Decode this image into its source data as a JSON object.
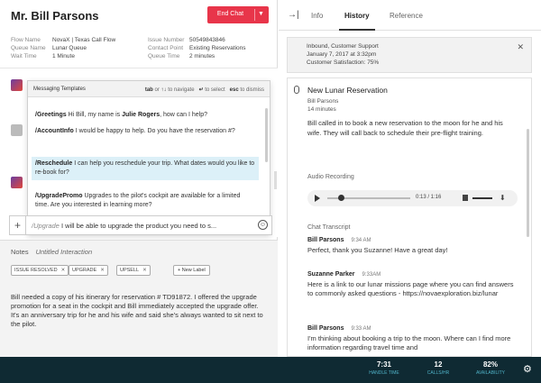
{
  "customer": {
    "name": "Mr. Bill Parsons"
  },
  "end_chat": {
    "label": "End Chat"
  },
  "info": [
    {
      "k1": "Flow Name",
      "v1": "NovaX | Texas Call Flow",
      "k2": "Issue Number",
      "v2": "50549843846"
    },
    {
      "k1": "Queue Name",
      "v1": "Lunar Queue",
      "k2": "Contact Point",
      "v2": "Existing Reservations"
    },
    {
      "k1": "Wait Time",
      "v1": "1 Minute",
      "k2": "Queue Time",
      "v2": "2 minutes"
    }
  ],
  "templates": {
    "title": "Messaging Templates",
    "hint_tab": "tab",
    "hint_or": "or",
    "hint_arrows": "↑↓",
    "hint_navigate": "to navigate",
    "hint_enter": "↵",
    "hint_select": "to select",
    "hint_esc": "esc",
    "hint_dismiss": "to dismiss",
    "items": [
      {
        "key": "/Greetings",
        "text": " Hi Bill, my name is ",
        "bold": "Julie Rogers",
        "tail": ", how can I help?"
      },
      {
        "key": "/AccountInfo",
        "text": " I would be happy to help.  Do you have the reservation #?",
        "bold": "",
        "tail": ""
      },
      {
        "key": "/Reschedule",
        "text": " I can help you reschedule your trip.  What dates would you like to re-book for?",
        "bold": "",
        "tail": ""
      },
      {
        "key": "/UpgradePromo",
        "text": " Upgrades to the pilot's cockpit are available for a limited time.  Are you interested in learning more?",
        "bold": "",
        "tail": ""
      }
    ]
  },
  "compose": {
    "plus": "+",
    "key": "/Upgrade",
    "text": " I will be able to upgrade the product you need to s..."
  },
  "notes": {
    "label": "Notes",
    "title": "Untitled Interaction",
    "tags": [
      "ISSUE RESOLVED",
      "UPGRADE",
      "UPSELL"
    ],
    "new_label": "New Label",
    "body": "Bill needed a copy of his itinerary for reservation # TD91872.  I offered the upgrade promotion for a seat in the cockpit and Bill immediately accepted the upgrade offer.  It's an anniversary trip for he and his wife and said she's always wanted to sit next to the pilot."
  },
  "tabs": [
    "Info",
    "History",
    "Reference"
  ],
  "active_tab": "History",
  "history_card": {
    "line1": "Inbound, Customer Support",
    "line2": "January 7, 2017 at 3:32pm",
    "line3": "Customer Satisfaction: 75%"
  },
  "reservation": {
    "title": "New Lunar Reservation",
    "name": "Bill Parsons",
    "duration": "14 minutes",
    "description": "Bill called in to book a new reservation to the moon for he and his wife.  They will call back to schedule their pre-flight training.",
    "audio_label": "Audio Recording",
    "audio_time": "0:13 / 1:16",
    "audio_progress": 0.17,
    "transcript_label": "Chat Transcript",
    "messages": [
      {
        "name": "Bill Parsons",
        "time": "9:34 AM",
        "text": "Perfect, thank you Suzanne!  Have a great day!"
      },
      {
        "name": "Suzanne Parker",
        "time": "9:33AM",
        "text": "Here is a link to our lunar missions page where you can find answers to commonly asked questions - https://novaexploration.biz/lunar"
      },
      {
        "name": "Bill Parsons",
        "time": "9:33 AM",
        "text": "I'm thinking about booking a trip to the moon.  Where can I find more information regarding travel time and"
      }
    ]
  },
  "footer": {
    "stats": [
      {
        "value": "7:31",
        "label": "HANDLE TIME"
      },
      {
        "value": "12",
        "label": "CALLS/HR"
      },
      {
        "value": "82%",
        "label": "AVAILABILITY"
      }
    ]
  },
  "colors": {
    "accent": "#e8354a",
    "footer_bg": "#0f2a33",
    "footer_label": "#4fb3c8",
    "selected": "#dcf0f8"
  },
  "icons": [
    "chevron-down-icon",
    "plus-icon",
    "smiley-icon",
    "close-icon",
    "collapse-panel-icon",
    "microphone-icon",
    "play-icon",
    "volume-icon",
    "download-icon",
    "gear-icon"
  ]
}
